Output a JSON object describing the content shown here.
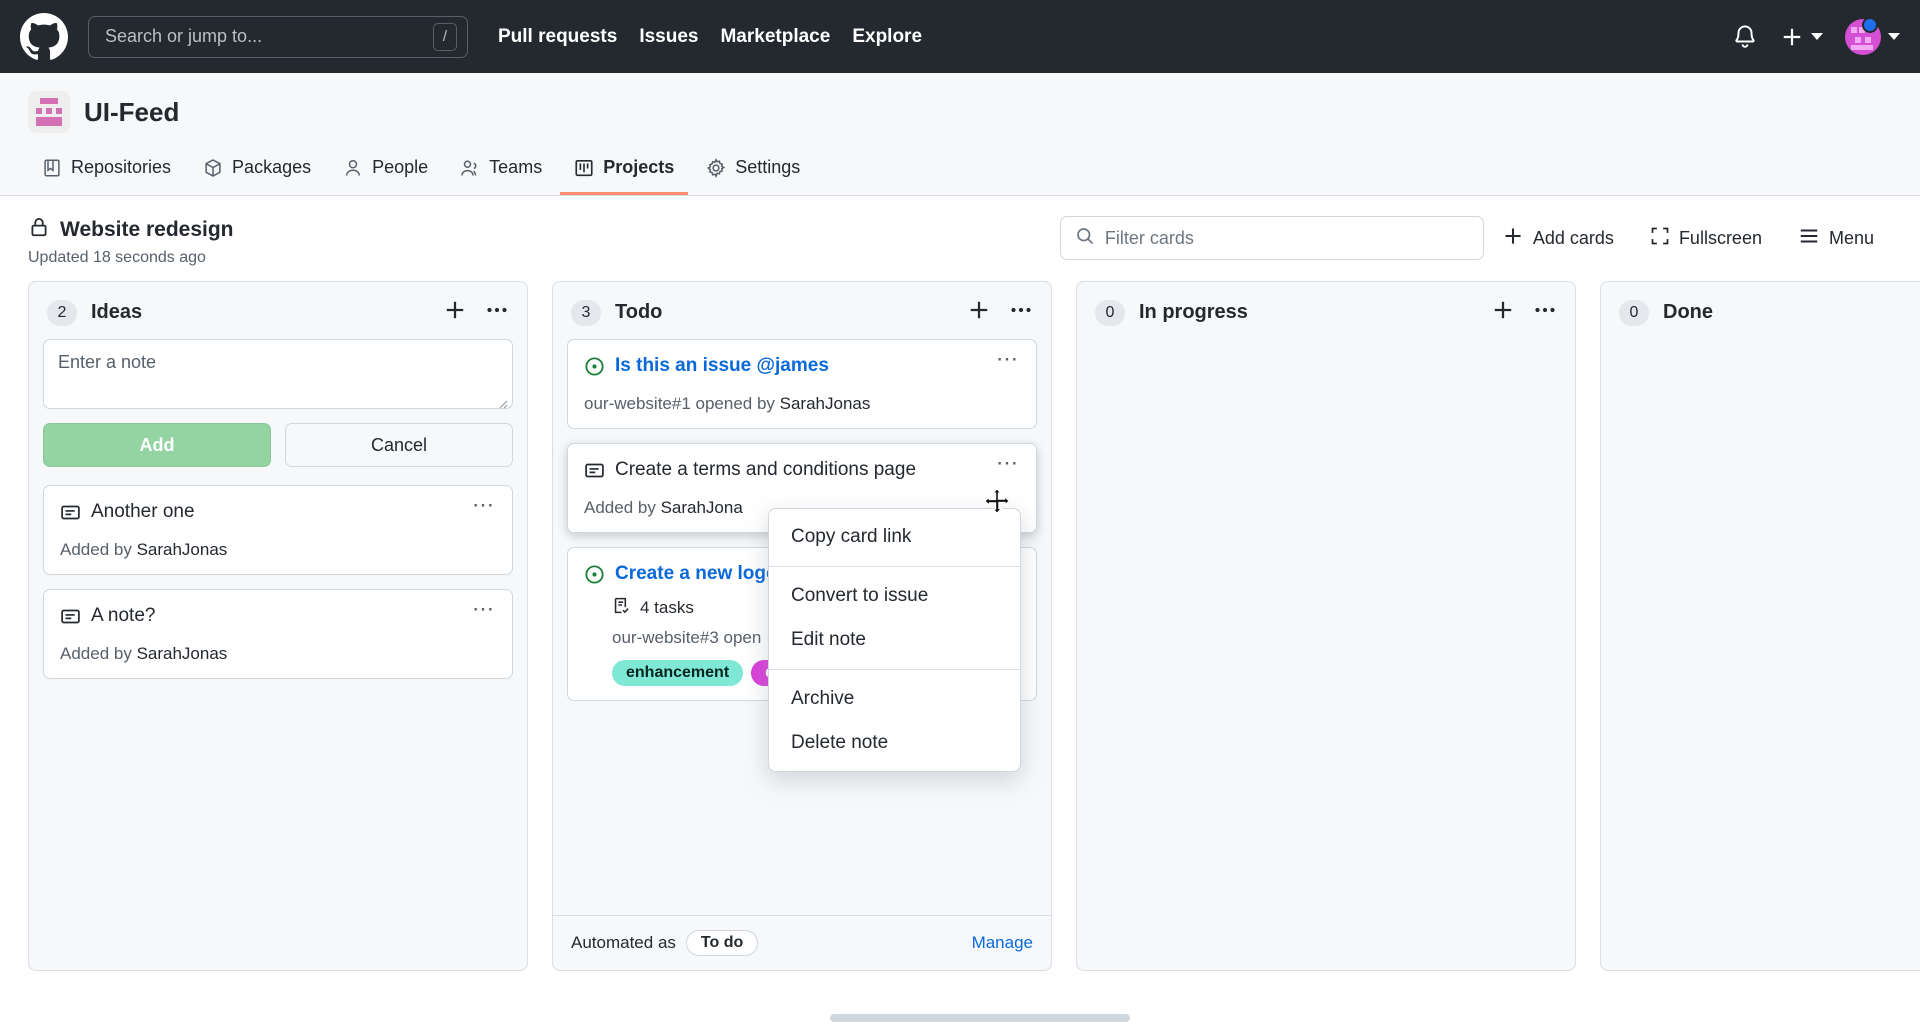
{
  "topbar": {
    "logo_icon": "github-mark-icon",
    "search_placeholder": "Search or jump to...",
    "search_value": "",
    "search_shortcut": "/",
    "nav": [
      {
        "label": "Pull requests"
      },
      {
        "label": "Issues"
      },
      {
        "label": "Marketplace"
      },
      {
        "label": "Explore"
      }
    ],
    "notifications_icon": "bell-icon",
    "create_new_icon": "plus-icon",
    "account_icon": "avatar"
  },
  "repo": {
    "owner_avatar_icon": "org-avatar",
    "name": "UI-Feed",
    "tabs": [
      {
        "label": "Repositories",
        "icon": "repo-icon",
        "active": false
      },
      {
        "label": "Packages",
        "icon": "package-icon",
        "active": false
      },
      {
        "label": "People",
        "icon": "person-icon",
        "active": false
      },
      {
        "label": "Teams",
        "icon": "people-icon",
        "active": false
      },
      {
        "label": "Projects",
        "icon": "project-board-icon",
        "active": true
      },
      {
        "label": "Settings",
        "icon": "gear-icon",
        "active": false
      }
    ]
  },
  "project": {
    "visibility_icon": "lock-icon",
    "title": "Website redesign",
    "updated": "Updated 18 seconds ago",
    "filter_placeholder": "Filter cards",
    "filter_value": "",
    "search_icon": "search-icon",
    "add_cards_label": "Add cards",
    "add_cards_icon": "plus-icon",
    "fullscreen_label": "Fullscreen",
    "fullscreen_icon": "fullscreen-icon",
    "menu_label": "Menu",
    "menu_icon": "hamburger-icon"
  },
  "columns": [
    {
      "name": "Ideas",
      "count": "2",
      "add_icon": "plus-icon",
      "menu_icon": "kebab-icon",
      "compose": {
        "placeholder": "Enter a note",
        "value": "",
        "add_label": "Add",
        "cancel_label": "Cancel"
      },
      "cards": [
        {
          "type": "note",
          "icon": "note-icon",
          "title": "Another one",
          "meta_prefix": "Added by ",
          "meta_author": "SarahJonas",
          "menu_icon": "kebab-icon"
        },
        {
          "type": "note",
          "icon": "note-icon",
          "title": "A note?",
          "meta_prefix": "Added by ",
          "meta_author": "SarahJonas",
          "menu_icon": "kebab-icon"
        }
      ]
    },
    {
      "name": "Todo",
      "count": "3",
      "add_icon": "plus-icon",
      "menu_icon": "kebab-icon",
      "cards": [
        {
          "type": "issue",
          "icon": "issue-opened-icon",
          "title": "Is this an issue @james",
          "meta": "our-website#1 opened by ",
          "meta_author": "SarahJonas",
          "menu_icon": "kebab-icon"
        },
        {
          "type": "note",
          "icon": "note-icon",
          "title": "Create a terms and conditions page",
          "meta_prefix": "Added by ",
          "meta_author": "SarahJona",
          "menu_icon": "kebab-icon",
          "dragging": true
        },
        {
          "type": "issue",
          "icon": "issue-opened-icon",
          "title": "Create a new logo",
          "tasks_icon": "tasklist-icon",
          "tasks_label": "4 tasks",
          "meta": "our-website#3 open",
          "labels": [
            {
              "text": "enhancement",
              "bg": "#7ee8d4",
              "fg": "#04251f"
            },
            {
              "text": "qu",
              "bg": "#d93fd9",
              "fg": "#ffffff"
            }
          ]
        }
      ],
      "footer": {
        "automated_prefix": "Automated as",
        "automated_value": "To do",
        "manage_label": "Manage"
      }
    },
    {
      "name": "In progress",
      "count": "0",
      "add_icon": "plus-icon",
      "menu_icon": "kebab-icon",
      "cards": []
    },
    {
      "name": "Done",
      "count": "0",
      "add_icon": "plus-icon",
      "menu_icon": "kebab-icon",
      "cards": []
    }
  ],
  "card_menu": {
    "groups": [
      {
        "items": [
          {
            "label": "Copy card link"
          }
        ]
      },
      {
        "items": [
          {
            "label": "Convert to issue"
          },
          {
            "label": "Edit note"
          }
        ]
      },
      {
        "items": [
          {
            "label": "Archive"
          },
          {
            "label": "Delete note"
          }
        ]
      }
    ]
  },
  "cursor": {
    "icon": "move-cursor"
  },
  "colors": {
    "header_bg": "#24292f",
    "accent_blue": "#0969da",
    "active_tab": "#fd8c73",
    "green_open": "#1a7f37"
  }
}
